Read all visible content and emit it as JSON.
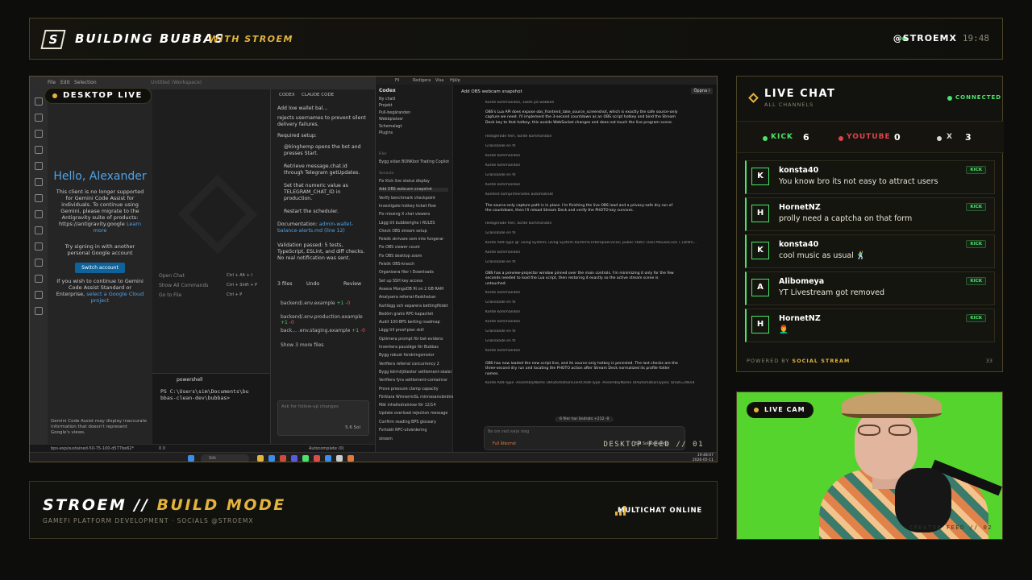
{
  "header": {
    "logo_letter": "S",
    "title": "BUILDING BUBBAS",
    "subtitle": "WITH STROEM",
    "handle": "@STROEMX",
    "time": "19:48"
  },
  "desktop": {
    "badge": "DESKTOP LIVE",
    "caption": "DESKTOP FEED // 01",
    "vscode": {
      "menu": [
        "File",
        "Edit",
        "Selection"
      ],
      "workspace_title": "Untitled (Workspace)",
      "gemini": {
        "hello": "Hello, Alexander",
        "notice": "This client is no longer supported for Gemini Code Assist for individuals. To continue using Gemini, please migrate to the Antigravity suite of products: https://antigravity.google",
        "learn_more": "Learn more",
        "try_signin": "Try signing in with another personal Google account",
        "switch_button": "Switch account",
        "continue_text": "If you wish to continue to Gemini Code Assist Standard or Enterprise,",
        "cloud_link": "select a Google Cloud project",
        "footer": "Gemini Code Assist may display inaccurate information that doesn't represent Google's views."
      },
      "commands": [
        {
          "label": "Open Chat",
          "keys": "Ctrl + Alt + I"
        },
        {
          "label": "Show All Commands",
          "keys": "Ctrl + Shift + P"
        },
        {
          "label": "Go to File",
          "keys": "Ctrl + P"
        }
      ],
      "agent": {
        "tab_codex": "CODEX",
        "tab_claude": "CLAUDE CODE",
        "task": "Add low wallet bal...",
        "intro": "rejects usernames to prevent silent delivery failures.",
        "setup_heading": "Required setup:",
        "steps": [
          "@kinghemp opens the bot and presses Start.",
          "Retrieve message.chat.id through Telegram getUpdates.",
          "Set that numeric value as TELEGRAM_CHAT_ID in production.",
          "Restart the scheduler."
        ],
        "docs_label": "Documentation:",
        "docs_link": "admin-wallet-balance-alerts.md (line 12)",
        "validation": "Validation passed: 5 tests, TypeScript, ESLint, and diff checks. No real notification was sent.",
        "files_count": "3 files",
        "undo": "Undo",
        "review": "Review",
        "diffs": [
          {
            "file": "backend/.env.example",
            "plus": "+1",
            "minus": "-0"
          },
          {
            "file": "backend/.env.production.example",
            "plus": "+1",
            "minus": "-0"
          },
          {
            "file": "back... .env.staging.example",
            "plus": "+1",
            "minus": "-0"
          }
        ],
        "show_more": "Show 3 more files",
        "input_placeholder": "Ask for follow-up changes",
        "model": "5.6 Sol"
      },
      "terminal": {
        "tab": "powershell",
        "line1": "PS C:\\Users\\sim\\Documents\\bu",
        "line2": "bbas-clean-dev\\bubbas>"
      },
      "status": {
        "branch": "bps-exp/sustained-50-75-100-d577be62*",
        "problems": "0 0",
        "autocomplete": "Autocomplete (0)"
      }
    },
    "codex": {
      "menu": [
        "Fil",
        "Redigera",
        "Visa",
        "Hjälp"
      ],
      "brand": "Codex",
      "nav": [
        "Ny chatt",
        "Projekt",
        "Pull-begäranden",
        "Webbplatser",
        "Schemalagt",
        "Plugins"
      ],
      "section_files": "Filer",
      "pinned": "Bygg sidan BONKbot Trading Copilot",
      "section_recent": "Senaste",
      "threads": [
        "Fix Kick live status display",
        "Add OBS webcam snapshot",
        "Verify benchmark checkpoint",
        "Investigate hotkey ticket flow",
        "Fix missing X chat viewers",
        "Lägg till bubblerighe i RULES",
        "Check OBS stream setup",
        "Felsök skrivare som inte fungerar",
        "Fix OBS viewer count",
        "Fix OBS desktop zoom",
        "Felsök OBS-krasch",
        "Organisera filer i Downloads",
        "Set up SSH key access",
        "Assess MongoDB fit on 2 GB RAM",
        "Analysera referral-flaskhalsar",
        "Kartlägg och separera bettingflödet",
        "Bedöm gratis RPC-kapacitet",
        "Audit 100-BPS betting roadmap",
        "Lägg till proof-plan skill",
        "Optimera prompt för bet-evidens",
        "Inventera pausläge för Bubbas",
        "Bygg robust fondningsmotor",
        "Verifiera referral concurrency 2",
        "Bygg körmiljötester settlement-skalor",
        "Verifiera fyra settlement-containrar",
        "Prove pressure clamp capacity",
        "Förklara WinnermiSL minnesanvändning",
        "Mät inhaltsdrainiow för 12/14",
        "Update overload rejection message",
        "Confirm reading BPS glossary",
        "Fortsätt RPC-utvärdering"
      ],
      "user": "stroem",
      "thread_title": "Add OBS webcam snapshot",
      "open_button": "Öppna i",
      "log_lines": [
        "Körde kommandon, sökte på webben",
        "Redigerade filer, körde kommandon",
        "Granskade en fil",
        "Körde kommandon",
        "Körde kommandon",
        "Granskade en fil",
        "Körde kommandon",
        "Kontext komprimerades automatiskt"
      ],
      "para1": "OBS's Lua API does expose obs_frontend_take_source_screenshot, which is exactly the safe source-only capture we need. I'll implement the 3-second countdown as an OBS script hotkey and bind the Stream Deck key to that hotkey; this avoids WebSocket changes and does not touch the live program scene.",
      "para2": "The source-only capture path is in place. I'm finishing the live OBS load and a privacy-safe dry run of the countdown, then I'll reload Stream Deck and verify the PHOTO key survives.",
      "log_lines_2": [
        "Redigerade filer, körde kommandon",
        "Granskade en fil",
        "Körde Add-Type @' using System; using System.Runtime.InteropServices; public static class MouseClick { [DllIm...",
        "Körde kommandon",
        "Granskade en fil"
      ],
      "para3": "OBS has a preview-projector window pinned over the main controls. I'm minimizing it only for the few seconds needed to load the Lua script, then restoring it exactly so the active stream scene is untouched.",
      "log_lines_3": [
        "Körde kommandon",
        "Granskade en fil",
        "Körde kommandon",
        "Körde kommandon",
        "Granskade en fil",
        "Granskade en fil",
        "Körde kommandon"
      ],
      "para4": "OBS has now loaded the new script live, and its source-only hotkey is persisted. The last checks are the three-second dry run and locating the PHOTO action after Stream Deck normalized its profile folder names.",
      "last_line": "Körde Add-Type -AssemblyName UIAutomationClient;Add-Type -AssemblyName UIAutomationTypes; $root=[Wind",
      "files_pill": "6 filer har ändrats +212 -0",
      "input_placeholder": "Be om ved varje steg",
      "access": "Full åtkomst",
      "model": "5.6 Sol Extra hög"
    },
    "taskbar": {
      "search": "Sök",
      "clock_time": "19:48:07",
      "clock_date": "2026-05-11"
    }
  },
  "bottom": {
    "title_a": "STROEM //",
    "title_b": "BUILD MODE",
    "subtitle": "GAMEFI PLATFORM DEVELOPMENT · SOCIALS @STROEMX",
    "status": "MULTICHAT ONLINE"
  },
  "chat": {
    "title": "LIVE CHAT",
    "subtitle": "ALL CHANNELS",
    "status": "CONNECTED",
    "platforms": [
      {
        "name": "KICK",
        "count": "6",
        "color": "#4be36a"
      },
      {
        "name": "YOUTUBE",
        "count": "0",
        "color": "#e0434c"
      },
      {
        "name": "X",
        "count": "3",
        "color": "#d8d8d8"
      }
    ],
    "messages": [
      {
        "initial": "K",
        "user": "konsta40",
        "text": "You know bro its not easy to attract users",
        "tag": "KICK"
      },
      {
        "initial": "H",
        "user": "HornetNZ",
        "text": "prolly need a captcha on that form",
        "tag": "KICK"
      },
      {
        "initial": "K",
        "user": "konsta40",
        "text": "cool music as usual 🕺",
        "tag": "KICK"
      },
      {
        "initial": "A",
        "user": "Alibomeya",
        "text": "YT Livestream got removed",
        "tag": "KICK"
      },
      {
        "initial": "H",
        "user": "HornetNZ",
        "text": "👨‍🦰",
        "tag": "KICK"
      }
    ],
    "footer_prefix": "POWERED BY",
    "footer_brand": "SOCIAL STREAM",
    "footer_count": "33"
  },
  "cam": {
    "badge": "LIVE CAM",
    "caption": "CREATOR FEED // 02"
  }
}
